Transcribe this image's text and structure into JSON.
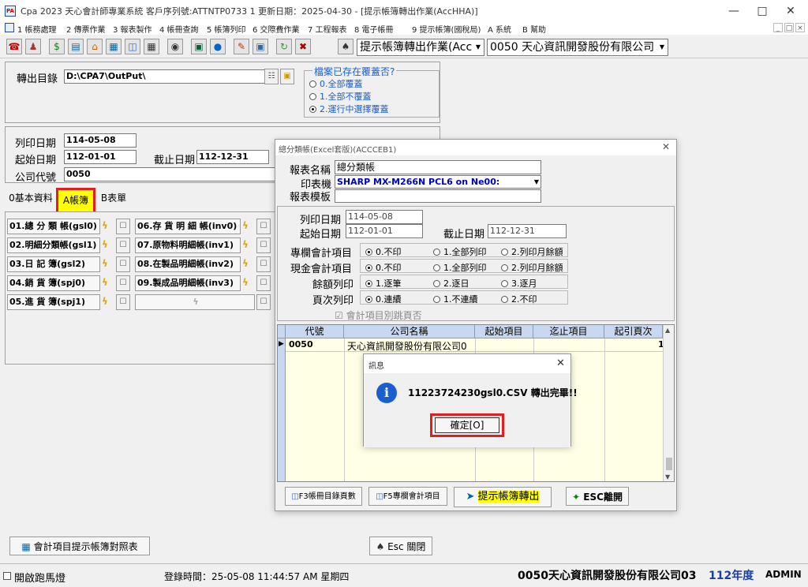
{
  "window": {
    "title": "Cpa 2023  天心會計師專業系統  客戶序列號:ATTNTP0733 1   更新日期：2025-04-30 - [提示帳簿轉出作業(AccHHA)]",
    "app_icon": "PA"
  },
  "menu": {
    "items": [
      "1 帳務處理",
      "2 傳票作業",
      "3 報表製作",
      "4 帳冊查詢",
      "5 帳簿列印",
      "6 交際費作業",
      "7 工程報表",
      "8 電子帳冊",
      "9 提示帳簿(國稅局)",
      "A 系統",
      "B 幫助"
    ]
  },
  "toolbar": {
    "icons": [
      "phone-icon",
      "people-icon",
      "dollar-icon",
      "table-icon",
      "home-icon",
      "grid-icon",
      "pages-icon",
      "calculator-icon",
      "eye-icon",
      "monitor-icon",
      "globe-icon",
      "paint-icon",
      "picture-icon",
      "refresh-icon",
      "exit-icon"
    ],
    "function_combo": "提示帳簿轉出作業(Acc",
    "company_combo": "0050  天心資訊開發股份有限公司"
  },
  "export": {
    "dir_label": "轉出目錄",
    "dir_value": "D:\\CPA7\\OutPut\\",
    "overwrite_legend": "檔案已存在覆蓋否?",
    "options": [
      "0.全部覆蓋",
      "1.全部不覆蓋",
      "2.運行中選擇覆蓋"
    ],
    "selected_option": 2
  },
  "dates": {
    "print_date_label": "列印日期",
    "print_date": "114-05-08",
    "start_date_label": "起始日期",
    "start_date": "112-01-01",
    "end_date_label": "截止日期",
    "end_date": "112-12-31",
    "company_label": "公司代號",
    "company_code": "0050"
  },
  "tabs": [
    "0基本資料",
    "A帳簿",
    "B表單"
  ],
  "ledger_buttons": {
    "left": [
      "01.總 分 類 帳(gsl0)",
      "02.明細分類帳(gsl1)",
      "03.日    記    簿(gsl2)",
      "04.銷    貨    簿(spj0)",
      "05.進    貨    簿(spj1)"
    ],
    "right": [
      "06.存 貨 明 細 帳(inv0)",
      "07.原物料明細帳(inv1)",
      "08.在製品明細帳(inv2)",
      "09.製成品明細帳(inv3)",
      ""
    ]
  },
  "bottom": {
    "map_button": "會計項目提示帳簿對照表",
    "close_button": "Esc 關閉"
  },
  "status": {
    "marquee_label": "開啟跑馬燈",
    "login_time": "登錄時間：25-05-08 11:44:57 AM  星期四",
    "company": "0050天心資訊開發股份有限公司03",
    "year": "112年度",
    "user": "ADMIN"
  },
  "report_dialog": {
    "title": "總分類帳(Excel套版)(ACCCEB1)",
    "report_name_label": "報表名稱",
    "report_name": "總分類帳",
    "printer_label": "印表機",
    "printer": "SHARP MX-M266N PCL6 on Ne00:",
    "template_label": "報表模板",
    "template": "",
    "print_date_label": "列印日期",
    "print_date": "114-05-08",
    "start_date_label": "起始日期",
    "start_date": "112-01-01",
    "end_date_label": "截止日期",
    "end_date": "112-12-31",
    "rows": [
      {
        "label": "專欄會計項目",
        "options": [
          "0.不印",
          "1.全部列印",
          "2.列印月餘額"
        ],
        "selected": 0
      },
      {
        "label": "現金會計項目",
        "options": [
          "0.不印",
          "1.全部列印",
          "2.列印月餘額"
        ],
        "selected": 0
      },
      {
        "label": "餘額列印",
        "options": [
          "1.逐筆",
          "2.逐日",
          "3.逐月"
        ],
        "selected": 0
      },
      {
        "label": "頁次列印",
        "options": [
          "0.連續",
          "1.不連續",
          "2.不印"
        ],
        "selected": 0
      }
    ],
    "page_break_label": "會計項目別跳頁否",
    "grid": {
      "headers": [
        "代號",
        "公司名稱",
        "起始項目",
        "迄止項目",
        "起引頁次"
      ],
      "row": {
        "code": "0050",
        "name": "天心資訊開發股份有限公司0",
        "start": "",
        "end": "",
        "page": "1"
      }
    },
    "buttons": {
      "f3": "F3帳冊目錄頁數",
      "f5": "F5專欄會計項目",
      "export": "提示帳簿轉出",
      "esc": "ESC離開"
    }
  },
  "message_box": {
    "title": "訊息",
    "message": "11223724230gsl0.CSV 轉出完畢!!",
    "ok": "確定[O]"
  },
  "colors": {
    "highlight_red": "#e02020",
    "highlight_yellow": "#ffff00",
    "link_blue": "#1a5fd0",
    "printer_blue": "#0000c0",
    "year_blue": "#1a3fa0"
  }
}
